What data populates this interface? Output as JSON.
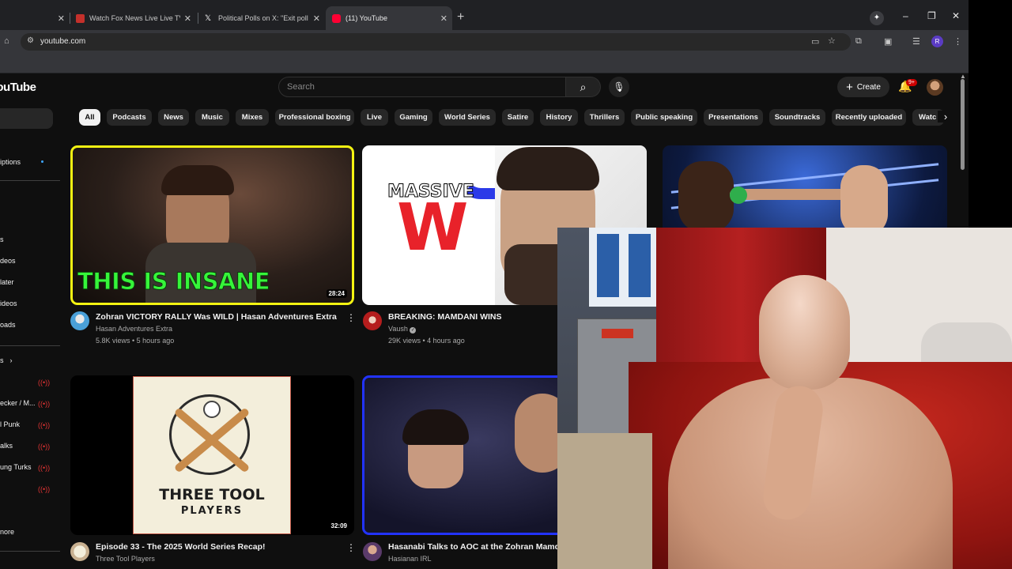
{
  "browser": {
    "tabs": [
      {
        "title": "Watch Fox News Live Live TV fr",
        "favicon_color": "#c4302b"
      },
      {
        "title": "Political Polls on X: \"Exit poll - F",
        "favicon_color": "#ffffff"
      },
      {
        "title": "(11) YouTube",
        "favicon_color": "#ff0033"
      }
    ],
    "url": "youtube.com",
    "profile_initial": "R"
  },
  "youtube": {
    "logo_text": "YouTube",
    "search_placeholder": "Search",
    "create_label": "Create",
    "notification_badge": "9+",
    "chips": [
      "All",
      "Podcasts",
      "News",
      "Music",
      "Mixes",
      "Professional boxing",
      "Live",
      "Gaming",
      "World Series",
      "Satire",
      "History",
      "Thrillers",
      "Public speaking",
      "Presentations",
      "Soundtracks",
      "Recently uploaded",
      "Watc"
    ],
    "sidebar": {
      "items": [
        "iptions",
        "s",
        "deos",
        "later",
        "ideos",
        "oads",
        "s",
        "ecker / M...",
        "l Punk",
        "alks",
        "ung Turks",
        "nore"
      ]
    },
    "videos": [
      {
        "thumb_text": "THIS IS INSANE",
        "duration": "28:24",
        "title": "Zohran VICTORY RALLY Was WILD | Hasan Adventures Extra",
        "channel": "Hasan Adventures Extra",
        "meta": "5.8K views • 5 hours ago"
      },
      {
        "thumb_text_top": "MASSIVE",
        "thumb_text_big": "W",
        "title": "BREAKING: MAMDANI WINS",
        "channel": "Vaush",
        "meta": "29K views • 4 hours ago"
      },
      {
        "title": "",
        "channel": "",
        "meta": ""
      },
      {
        "thumb_text_top": "THREE",
        "thumb_text_mid": "TOOL",
        "thumb_text_bot": "PLAYERS",
        "duration": "32:09",
        "title": "Episode 33 - The 2025 World Series Recap!",
        "channel": "Three Tool Players"
      },
      {
        "title": "Hasanabi Talks to AOC at the Zohran Mamdani",
        "channel": "Hasianan IRL"
      }
    ]
  },
  "colors": {
    "accent_red": "#ff0000",
    "yellow_border": "#f3f312",
    "blue_border": "#2233ff",
    "thumb_green": "#36f53a"
  }
}
